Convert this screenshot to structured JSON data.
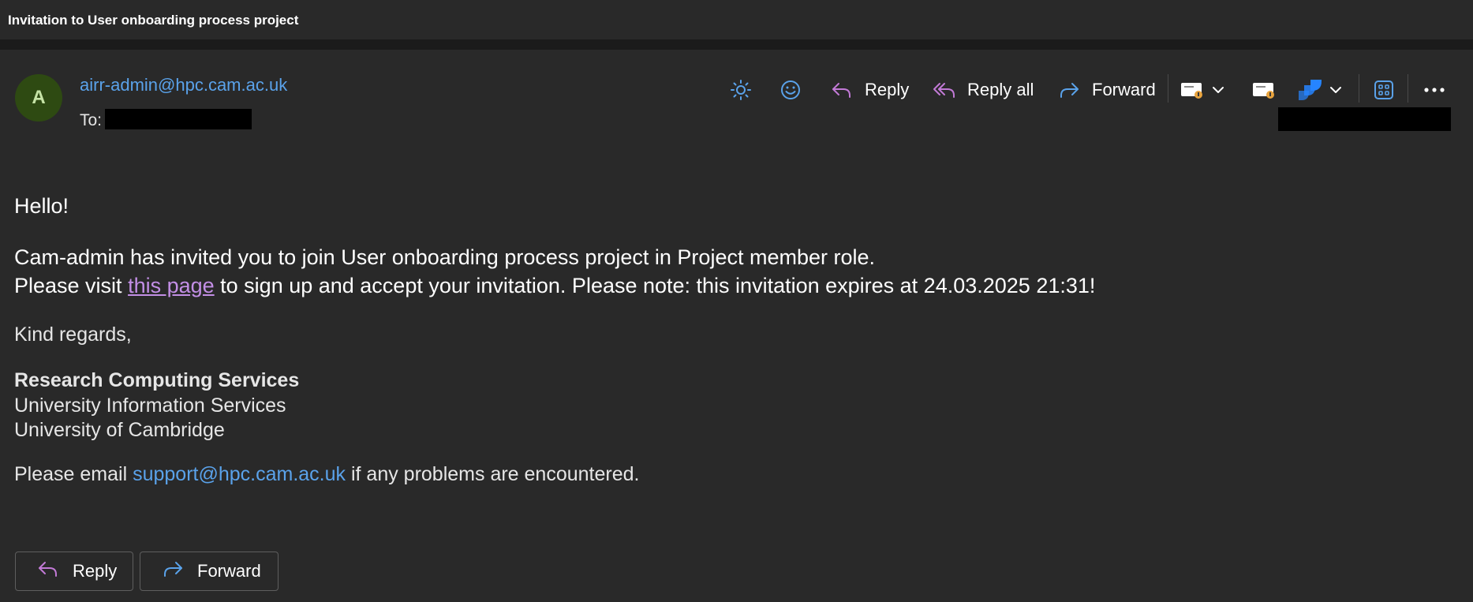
{
  "window": {
    "title": "Invitation to User onboarding process project"
  },
  "message": {
    "avatar_initial": "A",
    "sender": "airr-admin@hpc.cam.ac.uk",
    "to_label": "To:"
  },
  "toolbar": {
    "reply": "Reply",
    "reply_all": "Reply all",
    "forward": "Forward"
  },
  "body": {
    "greeting": "Hello!",
    "line1": "Cam-admin has invited you to join User onboarding process project in Project member role.",
    "line2_prefix": "Please visit ",
    "line2_link": "this page",
    "line2_suffix": " to sign up and accept your invitation. Please note: this invitation expires at 24.03.2025 21:31!",
    "regards": "Kind regards,",
    "signature_org": "Research Computing Services",
    "signature_dept": "University Information Services",
    "signature_univ": "University of Cambridge",
    "support_prefix": "Please email ",
    "support_email": "support@hpc.cam.ac.uk",
    "support_suffix": " if any problems are encountered."
  },
  "footer": {
    "reply": "Reply",
    "forward": "Forward"
  },
  "colors": {
    "background": "#292929",
    "link": "#5aa2ea",
    "visited_link": "#c38fe6",
    "reply_icon": "#c27ad6",
    "forward_icon": "#5aa2ea"
  },
  "icons": [
    "sun-icon",
    "smiley-icon",
    "reply-icon",
    "reply-all-icon",
    "forward-icon",
    "addin-card-icon",
    "chevron-down-icon",
    "addin-card-icon",
    "jira-icon",
    "apps-grid-icon",
    "more-icon"
  ]
}
